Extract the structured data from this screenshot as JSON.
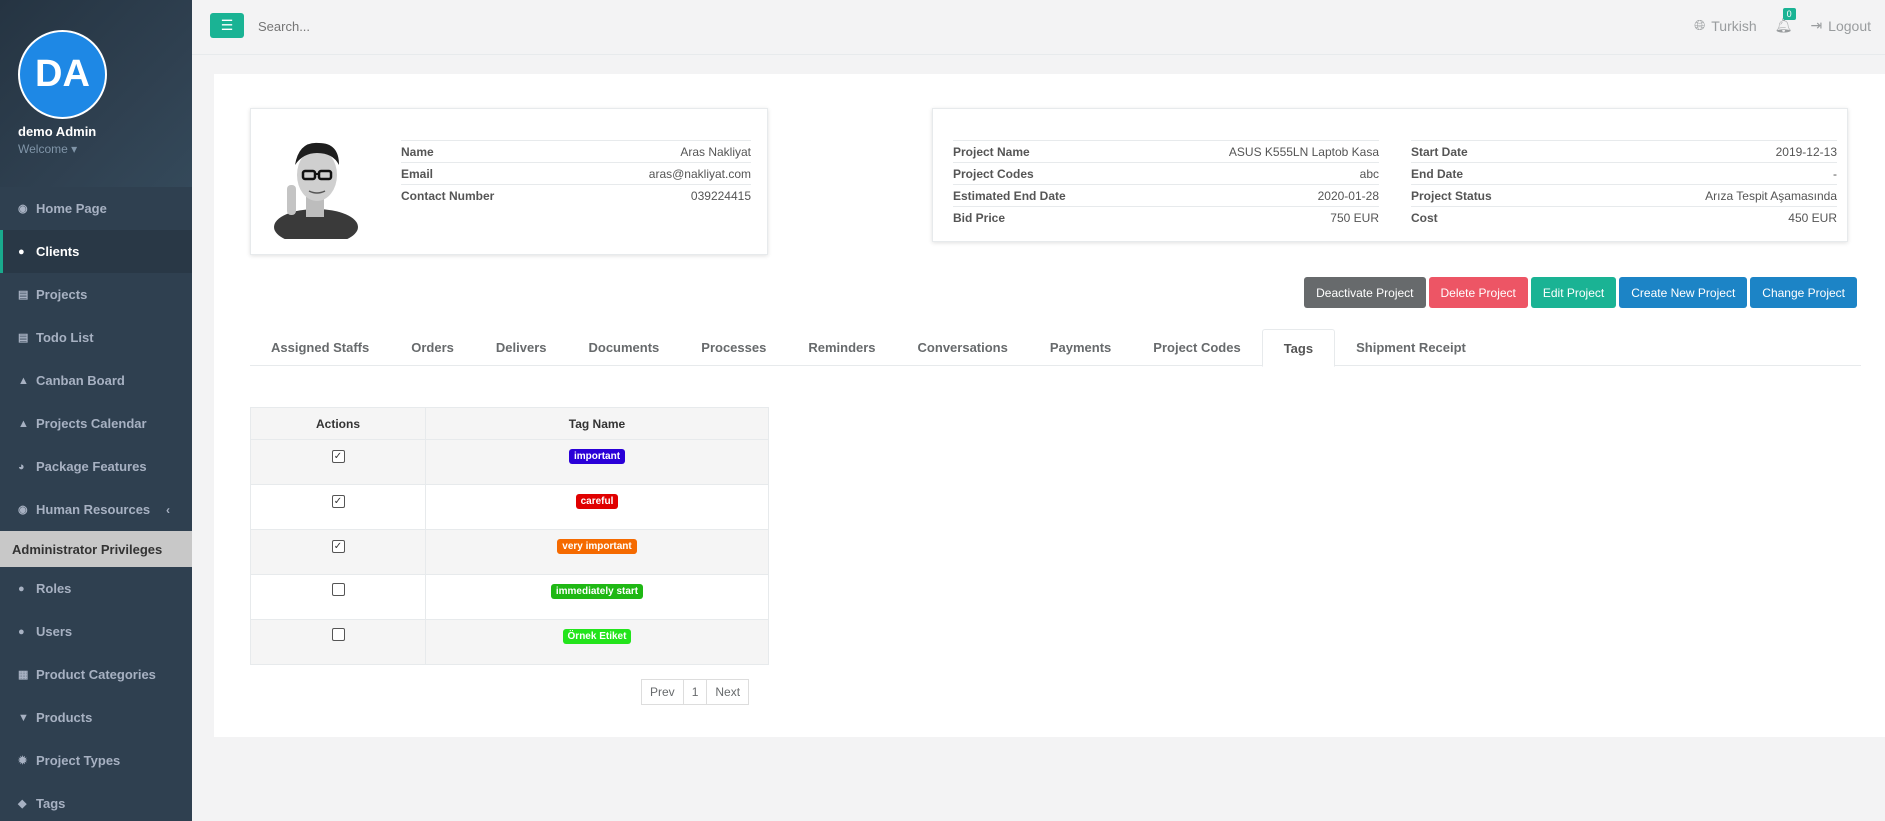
{
  "sidebar": {
    "avatar_initials": "DA",
    "user_name": "demo Admin",
    "welcome": "Welcome ▾",
    "items": [
      {
        "label": "Home Page",
        "icon": "dashboard-icon"
      },
      {
        "label": "Clients",
        "icon": "user-icon"
      },
      {
        "label": "Projects",
        "icon": "book-icon"
      },
      {
        "label": "Todo List",
        "icon": "book-icon"
      },
      {
        "label": "Canban Board",
        "icon": "road-icon"
      },
      {
        "label": "Projects Calendar",
        "icon": "road-icon"
      },
      {
        "label": "Package Features",
        "icon": "pie-chart-icon"
      },
      {
        "label": "Human Resources",
        "icon": "dashboard-icon"
      }
    ],
    "section": "Administrator Privileges",
    "admin_items": [
      {
        "label": "Roles",
        "icon": "users-icon"
      },
      {
        "label": "Users",
        "icon": "users-icon"
      },
      {
        "label": "Product Categories",
        "icon": "table-icon"
      },
      {
        "label": "Products",
        "icon": "cart-icon"
      },
      {
        "label": "Project Types",
        "icon": "gear-icon"
      },
      {
        "label": "Tags",
        "icon": "tags-icon"
      }
    ]
  },
  "topbar": {
    "search_placeholder": "Search...",
    "language": "Turkish",
    "notifications": "0",
    "logout": "Logout"
  },
  "client": {
    "name_label": "Name",
    "name": "Aras Nakliyat",
    "email_label": "Email",
    "email": "aras@nakliyat.com",
    "contact_label": "Contact Number",
    "contact": "039224415"
  },
  "project": {
    "name_label": "Project Name",
    "name": "ASUS K555LN Laptob Kasa",
    "codes_label": "Project Codes",
    "codes": "abc",
    "est_end_label": "Estimated End Date",
    "est_end": "2020-01-28",
    "bid_label": "Bid Price",
    "bid": "750 EUR",
    "start_label": "Start Date",
    "start": "2019-12-13",
    "end_label": "End Date",
    "end": "-",
    "status_label": "Project Status",
    "status": "Arıza Tespit Aşamasında",
    "cost_label": "Cost",
    "cost": "450 EUR"
  },
  "actions": {
    "deactivate": "Deactivate Project",
    "delete": "Delete Project",
    "edit": "Edit Project",
    "create": "Create New Project",
    "change": "Change Project"
  },
  "tabs": [
    "Assigned Staffs",
    "Orders",
    "Delivers",
    "Documents",
    "Processes",
    "Reminders",
    "Conversations",
    "Payments",
    "Project Codes",
    "Tags",
    "Shipment Receipt"
  ],
  "tag_table": {
    "col_actions": "Actions",
    "col_name": "Tag Name",
    "rows": [
      {
        "checked": true,
        "name": "important",
        "color": "#2a00d8"
      },
      {
        "checked": true,
        "name": "careful",
        "color": "#e00000"
      },
      {
        "checked": true,
        "name": "very important",
        "color": "#f56a00"
      },
      {
        "checked": false,
        "name": "immediately start",
        "color": "#1fb814"
      },
      {
        "checked": false,
        "name": "Örnek Etiket",
        "color": "#23e41c"
      }
    ]
  },
  "pager": {
    "prev": "Prev",
    "page": "1",
    "next": "Next"
  }
}
